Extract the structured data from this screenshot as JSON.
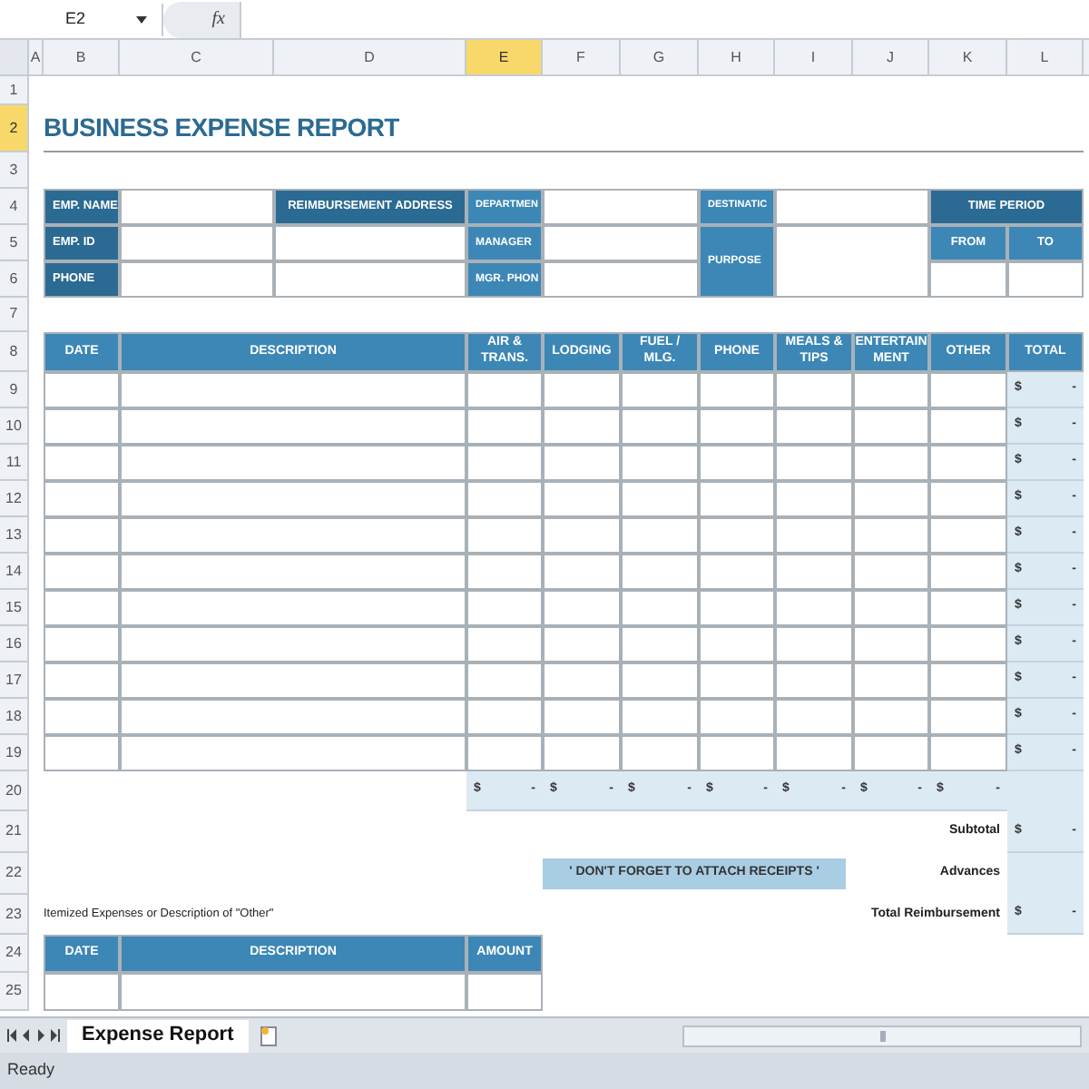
{
  "formula_bar": {
    "name_box": "E2",
    "function_label": "fx"
  },
  "column_headers": [
    {
      "label": "A",
      "selected": false
    },
    {
      "label": "B",
      "selected": false
    },
    {
      "label": "C",
      "selected": false
    },
    {
      "label": "D",
      "selected": false
    },
    {
      "label": "E",
      "selected": true
    },
    {
      "label": "F",
      "selected": false
    },
    {
      "label": "G",
      "selected": false
    },
    {
      "label": "H",
      "selected": false
    },
    {
      "label": "I",
      "selected": false
    },
    {
      "label": "J",
      "selected": false
    },
    {
      "label": "K",
      "selected": false
    },
    {
      "label": "L",
      "selected": false
    }
  ],
  "row_headers": [
    {
      "label": "1",
      "selected": false
    },
    {
      "label": "2",
      "selected": true
    },
    {
      "label": "3",
      "selected": false
    },
    {
      "label": "4",
      "selected": false
    },
    {
      "label": "5",
      "selected": false
    },
    {
      "label": "6",
      "selected": false
    },
    {
      "label": "7",
      "selected": false
    },
    {
      "label": "8",
      "selected": false
    },
    {
      "label": "9",
      "selected": false
    },
    {
      "label": "10",
      "selected": false
    },
    {
      "label": "11",
      "selected": false
    },
    {
      "label": "12",
      "selected": false
    },
    {
      "label": "13",
      "selected": false
    },
    {
      "label": "14",
      "selected": false
    },
    {
      "label": "15",
      "selected": false
    },
    {
      "label": "16",
      "selected": false
    },
    {
      "label": "17",
      "selected": false
    },
    {
      "label": "18",
      "selected": false
    },
    {
      "label": "19",
      "selected": false
    },
    {
      "label": "20",
      "selected": false
    },
    {
      "label": "21",
      "selected": false
    },
    {
      "label": "22",
      "selected": false
    },
    {
      "label": "23",
      "selected": false
    },
    {
      "label": "24",
      "selected": false
    },
    {
      "label": "25",
      "selected": false
    }
  ],
  "title": "BUSINESS EXPENSE REPORT",
  "employee_info": {
    "emp_name": "EMP. NAME",
    "emp_id": "EMP. ID",
    "phone": "PHONE",
    "reimbursement_address": "REIMBURSEMENT ADDRESS",
    "department": "DEPARTMEN",
    "manager": "MANAGER",
    "manager_phone": "MGR. PHON",
    "destination": "DESTINATIC",
    "purpose": "PURPOSE",
    "time_period": "TIME PERIOD",
    "from": "FROM",
    "to": "TO"
  },
  "expense_table": {
    "columns": [
      "DATE",
      "DESCRIPTION",
      "AIR & TRANS.",
      "LODGING",
      "FUEL / MLG.",
      "PHONE",
      "MEALS & TIPS",
      "ENTERTAIN MENT",
      "OTHER",
      "TOTAL"
    ],
    "rows": [
      {
        "currency": "$",
        "amount": "-"
      },
      {
        "currency": "$",
        "amount": "-"
      },
      {
        "currency": "$",
        "amount": "-"
      },
      {
        "currency": "$",
        "amount": "-"
      },
      {
        "currency": "$",
        "amount": "-"
      },
      {
        "currency": "$",
        "amount": "-"
      },
      {
        "currency": "$",
        "amount": "-"
      },
      {
        "currency": "$",
        "amount": "-"
      },
      {
        "currency": "$",
        "amount": "-"
      },
      {
        "currency": "$",
        "amount": "-"
      },
      {
        "currency": "$",
        "amount": "-"
      }
    ],
    "column_totals": [
      {
        "currency": "$",
        "amount": "-"
      },
      {
        "currency": "$",
        "amount": "-"
      },
      {
        "currency": "$",
        "amount": "-"
      },
      {
        "currency": "$",
        "amount": "-"
      },
      {
        "currency": "$",
        "amount": "-"
      },
      {
        "currency": "$",
        "amount": "-"
      },
      {
        "currency": "$",
        "amount": "-"
      }
    ]
  },
  "summary": [
    {
      "label": "Subtotal",
      "currency": "$",
      "amount": "-"
    },
    {
      "label": "Advances"
    },
    {
      "label": "Total Reimbursement",
      "currency": "$",
      "amount": "-"
    }
  ],
  "notice": "' DON'T FORGET TO ATTACH RECEIPTS '",
  "itemized": {
    "caption": "Itemized Expenses or Description of \"Other\"",
    "columns": [
      "DATE",
      "DESCRIPTION",
      "AMOUNT"
    ]
  },
  "sheet_tabs": [
    {
      "label": "Expense Report",
      "selected": true
    }
  ],
  "status": "Ready"
}
